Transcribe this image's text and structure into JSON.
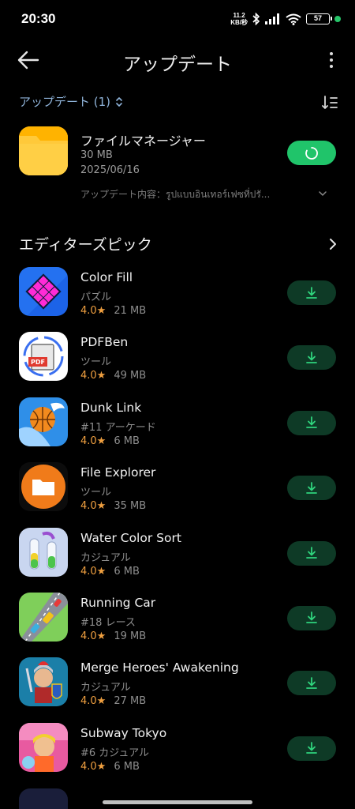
{
  "status_bar": {
    "time": "20:30",
    "speed_value": "11.2",
    "speed_unit": "KB/秒",
    "battery": "57"
  },
  "header": {
    "title": "アップデート"
  },
  "updates": {
    "section_label": "アップデート (1)",
    "item": {
      "name": "ファイルマネージャー",
      "size": "30 MB",
      "date": "2025/06/16",
      "notes": "アップデート内容：รูปแบบอินเทอร์เฟซที่ปรั...",
      "button_state": "updating"
    }
  },
  "picks": {
    "title": "エディターズピック",
    "apps": [
      {
        "name": "Color Fill",
        "category": "パズル",
        "rating": "4.0★",
        "size": "21 MB"
      },
      {
        "name": "PDFBen",
        "category": "ツール",
        "rating": "4.0★",
        "size": "49 MB"
      },
      {
        "name": "Dunk Link",
        "category": "#11 アーケード",
        "rating": "4.0★",
        "size": "6 MB"
      },
      {
        "name": "File Explorer",
        "category": "ツール",
        "rating": "4.0★",
        "size": "35 MB"
      },
      {
        "name": "Water Color Sort",
        "category": "カジュアル",
        "rating": "4.0★",
        "size": "6 MB"
      },
      {
        "name": "Running Car",
        "category": "#18 レース",
        "rating": "4.0★",
        "size": "19 MB"
      },
      {
        "name": "Merge Heroes' Awakening",
        "category": "カジュアル",
        "rating": "4.0★",
        "size": "27 MB"
      },
      {
        "name": "Subway Tokyo",
        "category": "#6 カジュアル",
        "rating": "4.0★",
        "size": "6 MB"
      }
    ]
  },
  "colors": {
    "accent_green": "#20c46a",
    "download_button_bg": "#0e3a26",
    "rating_orange": "#f0a040",
    "section_label_blue": "#8fb3d9"
  },
  "icons": [
    "back-arrow-icon",
    "more-vertical-icon",
    "sort-icon",
    "chevron-updown-icon",
    "chevron-down-icon",
    "chevron-right-icon",
    "download-icon",
    "loading-spinner-icon"
  ]
}
